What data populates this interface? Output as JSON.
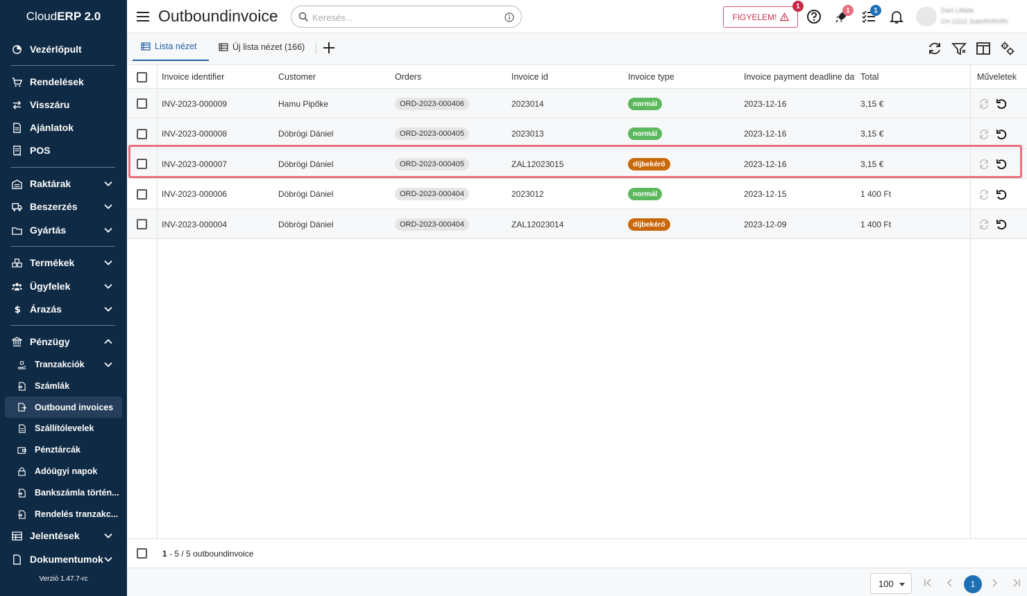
{
  "app": {
    "brand_prefix": "Cloud",
    "brand_bold": "ERP 2.0",
    "version": "Verzió 1.47.7-rc"
  },
  "sidebar": {
    "items": [
      {
        "label": "Vezérlőpult",
        "icon": "dashboard-icon"
      },
      {
        "label": "Rendelések",
        "icon": "cart-icon"
      },
      {
        "label": "Visszáru",
        "icon": "swap-icon"
      },
      {
        "label": "Ajánlatok",
        "icon": "document-icon"
      },
      {
        "label": "POS",
        "icon": "receipt-icon"
      },
      {
        "label": "Raktárak",
        "icon": "warehouse-icon"
      },
      {
        "label": "Beszerzés",
        "icon": "truck-icon"
      },
      {
        "label": "Gyártás",
        "icon": "factory-icon"
      },
      {
        "label": "Termékek",
        "icon": "boxes-icon"
      },
      {
        "label": "Ügyfelek",
        "icon": "users-icon"
      },
      {
        "label": "Árazás",
        "icon": "dollar-icon"
      },
      {
        "label": "Pénzügy",
        "icon": "bank-icon"
      },
      {
        "label": "Jelentések",
        "icon": "table-icon"
      },
      {
        "label": "Dokumentumok",
        "icon": "file-icon"
      }
    ],
    "sub_items": [
      {
        "label": "Tranzakciók"
      },
      {
        "label": "Számlák"
      },
      {
        "label": "Outbound invoices"
      },
      {
        "label": "Szállítólevelek"
      },
      {
        "label": "Pénztárcák"
      },
      {
        "label": "Adóügyi napok"
      },
      {
        "label": "Bankszámla történ..."
      },
      {
        "label": "Rendelés tranzakc..."
      }
    ]
  },
  "header": {
    "title": "Outboundinvoice",
    "search_placeholder": "Keresés...",
    "alert_label": "FIGYELEM!",
    "alert_badge": "1",
    "rocket_badge": "1",
    "tasks_badge": "1",
    "user_name": "Dani Lilláda",
    "user_id": "CH-11111 SubhRhRhRh"
  },
  "tabs": {
    "list_view": "Lista nézet",
    "new_list_view": "Új lista nézet (166)"
  },
  "table": {
    "columns": [
      "Invoice identifier",
      "Customer",
      "Orders",
      "Invoice id",
      "Invoice type",
      "Invoice payment deadline date",
      "Total",
      "Műveletek"
    ],
    "rows": [
      {
        "identifier": "INV-2023-000009",
        "customer": "Hamu Pipőke",
        "order": "ORD-2023-000406",
        "invoice_id": "2023014",
        "type": "normál",
        "deadline": "2023-12-16",
        "total": "3,15 €"
      },
      {
        "identifier": "INV-2023-000008",
        "customer": "Döbrögi Dániel",
        "order": "ORD-2023-000405",
        "invoice_id": "2023013",
        "type": "normál",
        "deadline": "2023-12-16",
        "total": "3,15 €"
      },
      {
        "identifier": "INV-2023-000007",
        "customer": "Döbrögi Dániel",
        "order": "ORD-2023-000405",
        "invoice_id": "ZAL12023015",
        "type": "díjbekérő",
        "deadline": "2023-12-16",
        "total": "3,15 €"
      },
      {
        "identifier": "INV-2023-000006",
        "customer": "Döbrögi Dániel",
        "order": "ORD-2023-000404",
        "invoice_id": "2023012",
        "type": "normál",
        "deadline": "2023-12-15",
        "total": "1 400 Ft"
      },
      {
        "identifier": "INV-2023-000004",
        "customer": "Döbrögi Dániel",
        "order": "ORD-2023-000404",
        "invoice_id": "ZAL12023014",
        "type": "díjbekérő",
        "deadline": "2023-12-09",
        "total": "1 400 Ft"
      }
    ]
  },
  "footer": {
    "range": "1",
    "count_rest": " - 5 / 5 outboundinvoice",
    "page_size": "100",
    "current_page": "1"
  },
  "colors": {
    "sidebar_bg": "#0f2a45",
    "accent": "#1f6fb5",
    "normal_badge": "#5cb85c",
    "dijbekero_badge": "#c9680a",
    "alert": "#c2334f",
    "badge_red": "#c62a4a",
    "badge_blue": "#1f6fb5"
  }
}
